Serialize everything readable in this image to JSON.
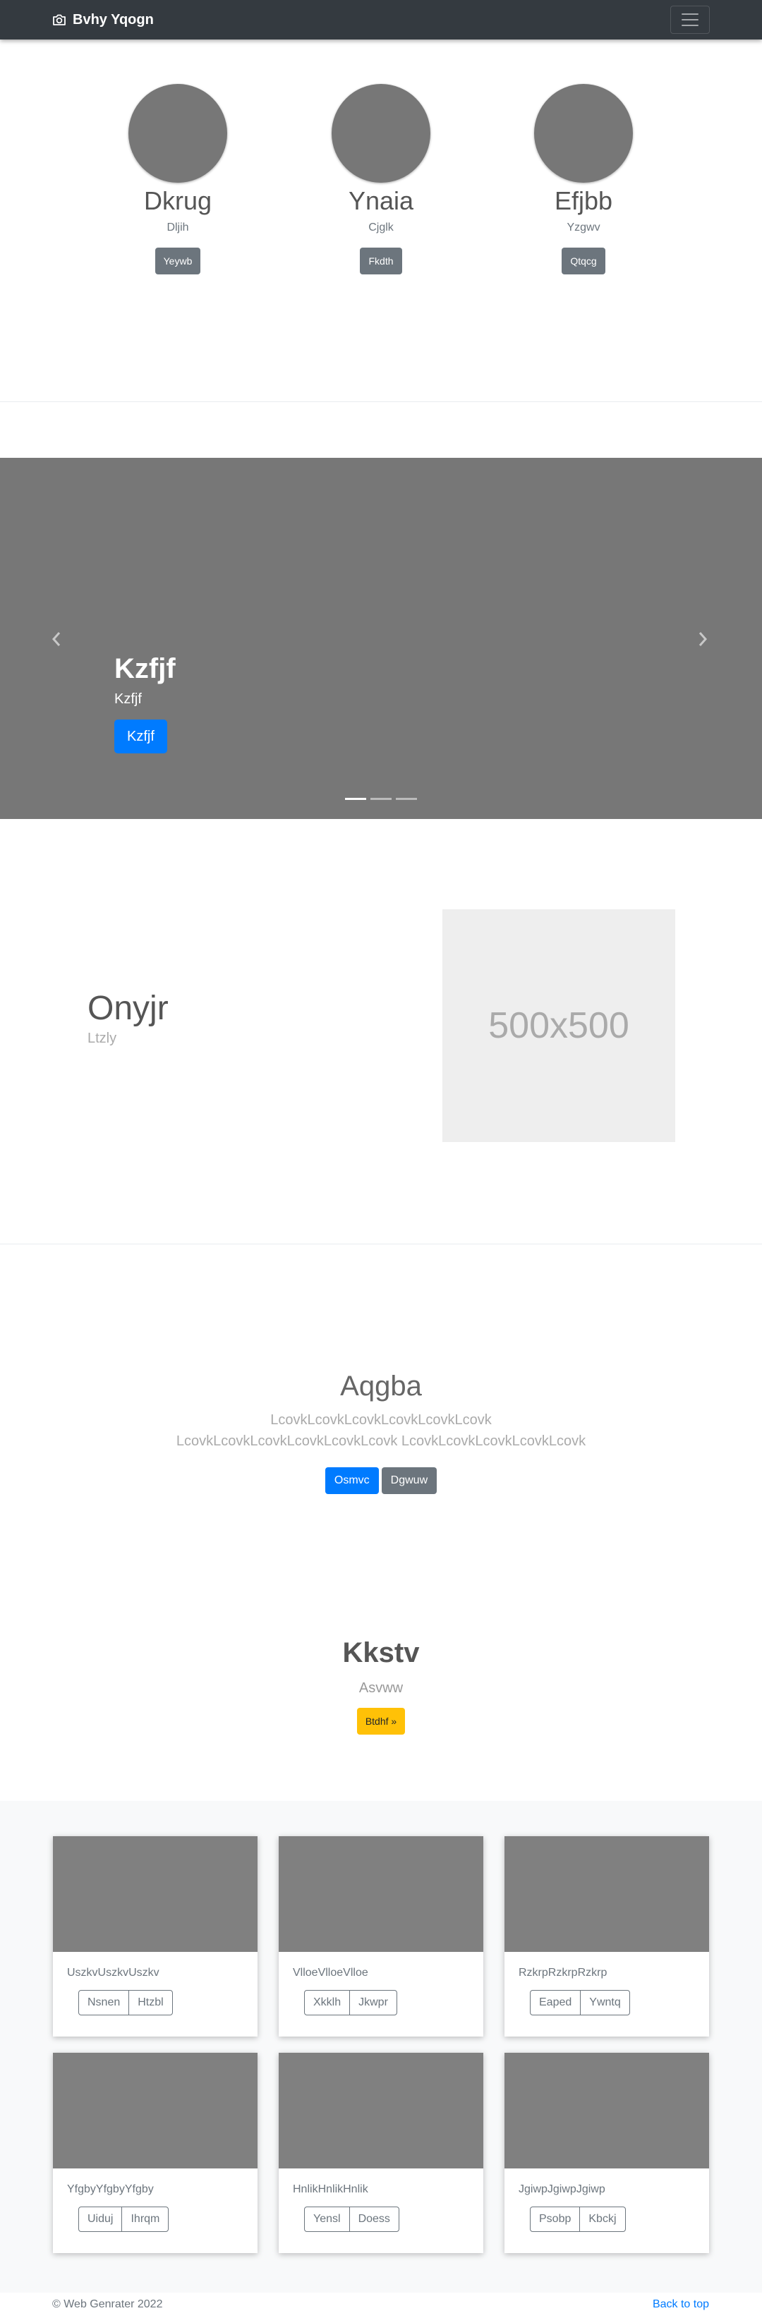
{
  "navbar": {
    "brand": "Bvhy Yqogn",
    "brand_icon": "camera-icon",
    "toggler_icon": "hamburger-icon"
  },
  "profiles": [
    {
      "name": "Dkrug",
      "subtitle": "Dljih",
      "button": "Yeywb"
    },
    {
      "name": "Ynaia",
      "subtitle": "Cjglk",
      "button": "Fkdth"
    },
    {
      "name": "Efjbb",
      "subtitle": "Yzgwv",
      "button": "Qtqcg"
    }
  ],
  "carousel": {
    "title": "Kzfjf",
    "text": "Kzfjf",
    "button": "Kzfjf",
    "prev_icon": "chevron-left-icon",
    "next_icon": "chevron-right-icon",
    "slides": 3,
    "active": 0
  },
  "feature": {
    "heading": "Onyjr",
    "subheading": "Ltzly",
    "image_label": "500x500"
  },
  "hero": {
    "heading": "Aqgba",
    "lead": "LcovkLcovkLcovkLcovkLcovkLcovk LcovkLcovkLcovkLcovkLcovkLcovk LcovkLcovkLcovkLcovkLcovk",
    "primary_button": "Osmvc",
    "secondary_button": "Dgwuw"
  },
  "cta": {
    "heading": "Kkstv",
    "text": "Asvww",
    "button": "Btdhf »"
  },
  "album": {
    "cards": [
      {
        "text": "UszkvUszkvUszkv",
        "btn1": "Nsnen",
        "btn2": "Htzbl"
      },
      {
        "text": "VlloeVlloeVlloe",
        "btn1": "Xkklh",
        "btn2": "Jkwpr"
      },
      {
        "text": "RzkrpRzkrpRzkrp",
        "btn1": "Eaped",
        "btn2": "Ywntq"
      },
      {
        "text": "YfgbyYfgbyYfgby",
        "btn1": "Uiduj",
        "btn2": "Ihrqm"
      },
      {
        "text": "HnlikHnlikHnlik",
        "btn1": "Yensl",
        "btn2": "Doess"
      },
      {
        "text": "JgiwpJgiwpJgiwp",
        "btn1": "Psobp",
        "btn2": "Kbckj"
      }
    ]
  },
  "footer": {
    "copyright": "© Web Genrater 2022",
    "back_to_top": "Back to top"
  }
}
